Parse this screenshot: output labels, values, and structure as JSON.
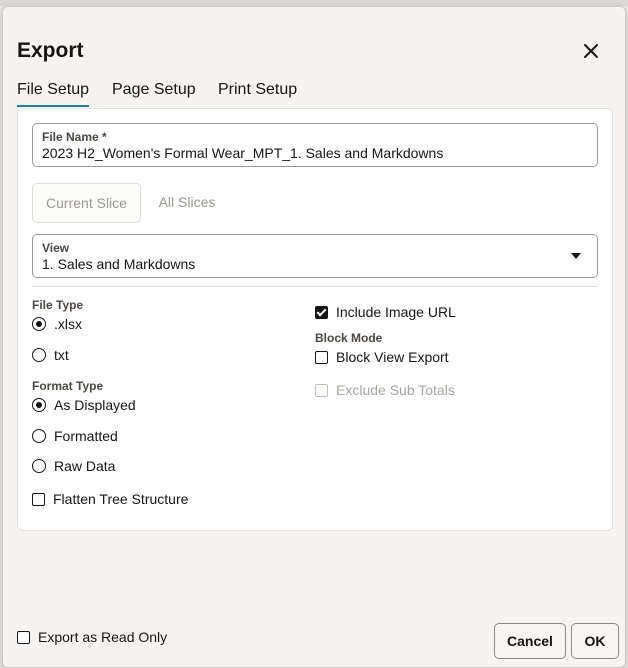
{
  "dialog": {
    "title": "Export",
    "tabs": [
      {
        "label": "File Setup",
        "active": true
      },
      {
        "label": "Page Setup",
        "active": false
      },
      {
        "label": "Print Setup",
        "active": false
      }
    ]
  },
  "file_setup": {
    "file_name": {
      "label": "File Name *",
      "value": "2023 H2_Women's Formal Wear_MPT_1. Sales and Markdowns"
    },
    "slice_toggle": {
      "options": [
        "Current Slice",
        "All Slices"
      ],
      "selected": "Current Slice"
    },
    "view": {
      "label": "View",
      "value": "1. Sales and Markdowns"
    },
    "file_type": {
      "label": "File Type",
      "options": [
        {
          "label": ".xlsx",
          "checked": true
        },
        {
          "label": "txt",
          "checked": false
        }
      ]
    },
    "format_type": {
      "label": "Format Type",
      "options": [
        {
          "label": "As Displayed",
          "checked": true
        },
        {
          "label": "Formatted",
          "checked": false
        },
        {
          "label": "Raw Data",
          "checked": false
        }
      ]
    },
    "flatten_tree": {
      "label": "Flatten Tree Structure",
      "checked": false
    },
    "include_image_url": {
      "label": "Include Image URL",
      "checked": true
    },
    "block_mode": {
      "label": "Block Mode",
      "block_view_export": {
        "label": "Block View Export",
        "checked": false
      },
      "exclude_sub_totals": {
        "label": "Exclude Sub Totals",
        "checked": false,
        "disabled": true
      }
    }
  },
  "footer": {
    "read_only": {
      "label": "Export as Read Only",
      "checked": false
    },
    "cancel_label": "Cancel",
    "ok_label": "OK"
  },
  "colors": {
    "accent": "#227e9e",
    "text": "#161513",
    "disabled": "#a9a5a0"
  }
}
